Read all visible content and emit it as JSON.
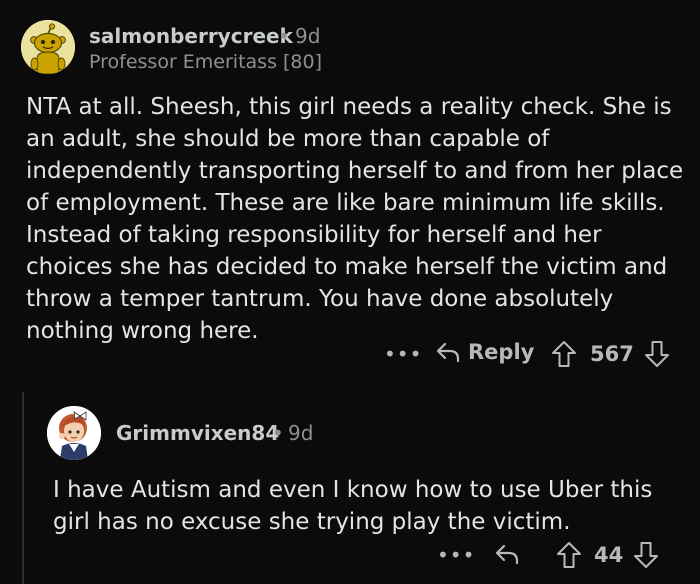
{
  "comment": {
    "username": "salmonberrycreek",
    "separator": "•",
    "age": "9d",
    "flair": "Professor Emeritass [80]",
    "body": "NTA at all. Sheesh, this girl needs a reality check. She is an adult, she should be more than capable of independently transporting herself to and from her place of employment. These are like bare minimum life skills. Instead of taking responsibility for herself and her choices she has decided to make herself the victim and throw a temper tantrum. You have done absolutely nothing wrong here.",
    "more_label": "•••",
    "reply_label": "Reply",
    "score": "567",
    "icons": {
      "avatar": "snoo-avatar",
      "reply": "reply-arrow-icon",
      "upvote": "upvote-arrow-icon",
      "downvote": "downvote-arrow-icon"
    }
  },
  "reply": {
    "username": "Grimmvixen84",
    "separator": "•",
    "age": "9d",
    "body": "I have Autism and even I know how to use Uber this girl has no excuse she trying play the victim.",
    "more_label": "•••",
    "score": "44",
    "icons": {
      "avatar": "cartoon-avatar",
      "reply": "reply-arrow-icon",
      "upvote": "upvote-arrow-icon",
      "downvote": "downvote-arrow-icon"
    }
  },
  "colors": {
    "background": "#0b0b0b",
    "text": "#e2e4e6",
    "meta": "#8e9194",
    "action": "#b6b9bc"
  }
}
